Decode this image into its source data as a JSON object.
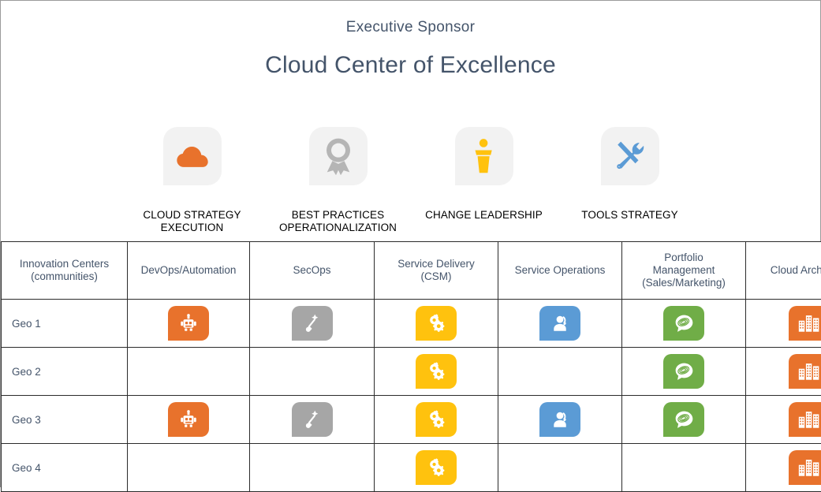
{
  "header": {
    "sponsor": "Executive  Sponsor",
    "title": "Cloud Center of Excellence"
  },
  "pillars": [
    {
      "label": "CLOUD STRATEGY\nEXECUTION",
      "icon": "cloud-icon",
      "color": "#E8722C",
      "tile_bg": "#F2F2F2"
    },
    {
      "label": "BEST PRACTICES\nOPERATIONALIZATION",
      "icon": "award-ribbon-icon",
      "color": "#B5B5B5",
      "tile_bg": "#F2F2F2"
    },
    {
      "label": "CHANGE LEADERSHIP",
      "icon": "podium-speaker-icon",
      "color": "#FFC20E",
      "tile_bg": "#F2F2F2"
    },
    {
      "label": "TOOLS STRATEGY",
      "icon": "wrench-screwdriver-icon",
      "color": "#5B9BD5",
      "tile_bg": "#F2F2F2"
    }
  ],
  "table": {
    "columns": [
      "Innovation Centers\n(communities)",
      "DevOps/Automation",
      "SecOps",
      "Service Delivery\n(CSM)",
      "Service Operations",
      "Portfolio\nManagement\n(Sales/Marketing)",
      "Cloud Architects"
    ],
    "badge_styles": [
      {
        "icon": "robot-icon",
        "color": "#E8722C"
      },
      {
        "icon": "torch-search-icon",
        "color": "#A6A6A6"
      },
      {
        "icon": "gears-icon",
        "color": "#FFC20E"
      },
      {
        "icon": "support-agent-icon",
        "color": "#5B9BD5"
      },
      {
        "icon": "broadcast-bubble-icon",
        "color": "#70AD47"
      },
      {
        "icon": "buildings-icon",
        "color": "#E8722C"
      }
    ],
    "rows": [
      {
        "label": "Geo 1",
        "cells": [
          true,
          true,
          true,
          true,
          true,
          true
        ]
      },
      {
        "label": "Geo 2",
        "cells": [
          false,
          false,
          true,
          false,
          true,
          true
        ]
      },
      {
        "label": "Geo 3",
        "cells": [
          true,
          true,
          true,
          true,
          true,
          true
        ]
      },
      {
        "label": "Geo 4",
        "cells": [
          false,
          false,
          true,
          false,
          false,
          true
        ]
      }
    ]
  }
}
